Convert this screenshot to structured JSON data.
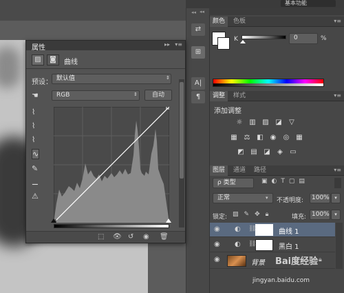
{
  "workspace": {
    "label": "基本功能"
  },
  "toolbar_dock": {
    "collapse_glyph": "◂◂",
    "menu_glyph": "▾≡",
    "items": [
      {
        "icon": "history-icon",
        "glyph": "⇄"
      },
      {
        "icon": "properties-icon",
        "glyph": "⊞"
      },
      {
        "icon": "character-icon",
        "glyph": "A|"
      },
      {
        "icon": "paragraph-icon",
        "glyph": "¶"
      }
    ]
  },
  "properties_panel": {
    "title": "属性",
    "collapse_glyph": "▸▸",
    "menu_glyph": "▾≡",
    "adjustment_name": "曲线",
    "preset_label": "预设：",
    "preset_value": "默认值",
    "channel_value": "RGB",
    "auto_label": "自动",
    "histogram_note": "histogram with peaks near right",
    "tool_icons": [
      "hand-icon",
      "eyedropper-black-icon",
      "eyedropper-gray-icon",
      "eyedropper-white-icon",
      "curve-tool-icon",
      "pencil-icon",
      "smooth-icon",
      "warning-icon"
    ]
  },
  "color_panel": {
    "tabs": [
      "颜色",
      "色板"
    ],
    "channel_label": "K",
    "value": "0",
    "unit": "%"
  },
  "adjustments_panel": {
    "tabs": [
      "调整",
      "样式"
    ],
    "heading": "添加调整"
  },
  "layers_panel": {
    "tabs": [
      "图层",
      "通道",
      "路径"
    ],
    "filter_label": "ρ 类型",
    "blend_mode": "正常",
    "opacity_label": "不透明度:",
    "opacity_value": "100%",
    "lock_label": "锁定:",
    "fill_label": "填充:",
    "fill_value": "100%",
    "layers": [
      {
        "name": "曲线 1",
        "selected": true
      },
      {
        "name": "黑白 1",
        "selected": false
      },
      {
        "name": "背景",
        "selected": false
      }
    ]
  },
  "watermark": {
    "text": "jingyan.baidu.com",
    "brand": "Bai度经验"
  },
  "colors": {
    "panel": "#535353",
    "dark": "#3a3a3a",
    "accent_selected": "#5a6a80"
  }
}
